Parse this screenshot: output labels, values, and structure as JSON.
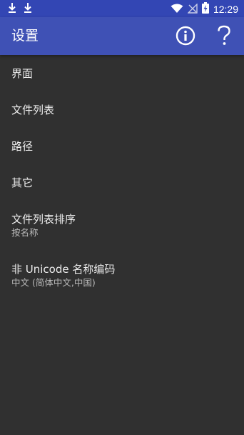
{
  "status_bar": {
    "time": "12:29",
    "icons": [
      "download-icon",
      "download-icon",
      "wifi-icon",
      "no-signal-icon",
      "battery-charging-icon"
    ]
  },
  "app_bar": {
    "title": "设置",
    "actions": [
      "info-icon",
      "help-icon"
    ]
  },
  "settings": [
    {
      "title": "界面"
    },
    {
      "title": "文件列表"
    },
    {
      "title": "路径"
    },
    {
      "title": "其它"
    },
    {
      "title": "文件列表排序",
      "summary": "按名称"
    },
    {
      "title": "非 Unicode 名称编码",
      "summary": "中文 (简体中文,中国)"
    }
  ],
  "colors": {
    "status_bar": "#3346b4",
    "app_bar": "#3f51b5",
    "background": "#303030"
  }
}
